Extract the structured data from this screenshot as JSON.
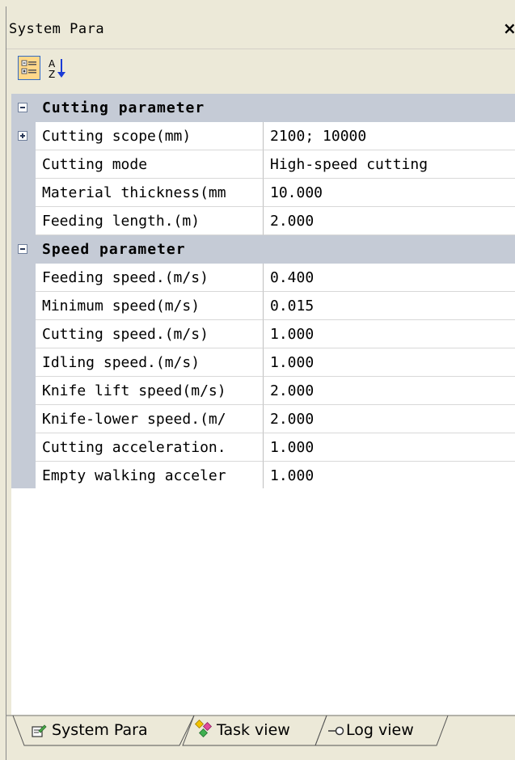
{
  "window": {
    "title": "System Para",
    "close_glyph": "×"
  },
  "toolbar": {
    "categorized_icon": "categorized-view-icon",
    "alphabetical_icon": "sort-az-icon"
  },
  "categories": [
    {
      "label": "Cutting parameter",
      "expanded": true,
      "rows": [
        {
          "name": "Cutting scope(mm)",
          "value": "2100; 10000",
          "expandable": true
        },
        {
          "name": "Cutting mode",
          "value": "High-speed cutting"
        },
        {
          "name": "Material thickness(mm",
          "value": "10.000"
        },
        {
          "name": "Feeding length.(m)",
          "value": "2.000"
        }
      ]
    },
    {
      "label": "Speed parameter",
      "expanded": true,
      "rows": [
        {
          "name": "Feeding speed.(m/s)",
          "value": "0.400"
        },
        {
          "name": "Minimum speed(m/s)",
          "value": "0.015"
        },
        {
          "name": "Cutting speed.(m/s)",
          "value": "1.000"
        },
        {
          "name": "Idling speed.(m/s)",
          "value": "1.000"
        },
        {
          "name": "Knife lift speed(m/s)",
          "value": "2.000"
        },
        {
          "name": "Knife-lower speed.(m/",
          "value": "2.000"
        },
        {
          "name": "Cutting acceleration.",
          "value": "1.000"
        },
        {
          "name": "Empty walking acceler",
          "value": "1.000"
        }
      ]
    }
  ],
  "tabs": [
    {
      "label": "System Para",
      "icon": "system-para-icon",
      "active": true
    },
    {
      "label": "Task view",
      "icon": "task-view-icon",
      "active": false
    },
    {
      "label": "Log view",
      "icon": "log-view-icon",
      "active": false
    }
  ],
  "colors": {
    "panel_bg": "#ece9d8",
    "category_bg": "#c5cbd6",
    "selected_button_bg": "#ffd88a"
  }
}
